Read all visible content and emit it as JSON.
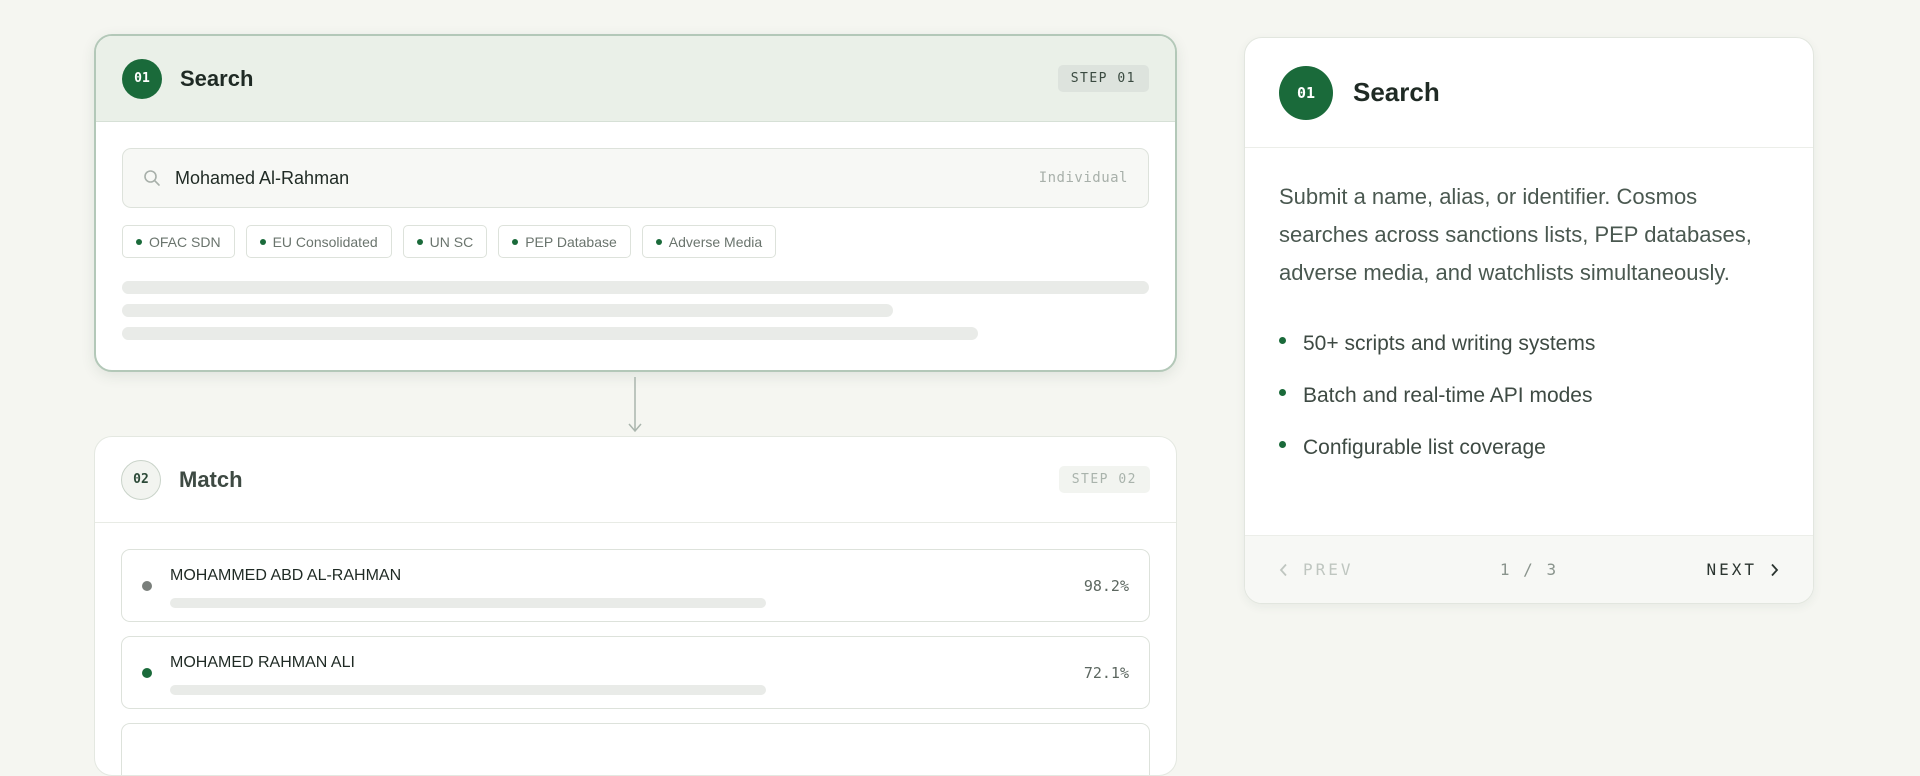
{
  "step1": {
    "number": "01",
    "title": "Search",
    "tag": "STEP 01",
    "search": {
      "value": "Mohamed Al-Rahman",
      "type": "Individual"
    },
    "chips": [
      "OFAC SDN",
      "EU Consolidated",
      "UN SC",
      "PEP Database",
      "Adverse Media"
    ]
  },
  "step2": {
    "number": "02",
    "title": "Match",
    "tag": "STEP 02",
    "matches": [
      {
        "name": "MOHAMMED ABD AL-RAHMAN",
        "score": "98.2%",
        "dot_color": "#7a7f7b"
      },
      {
        "name": "MOHAMED RAHMAN ALI",
        "score": "72.1%",
        "dot_color": "#1a6a3a"
      }
    ]
  },
  "panel": {
    "number": "01",
    "title": "Search",
    "description": "Submit a name, alias, or identifier. Cosmos searches across sanctions lists, PEP databases, adverse media, and watchlists simultaneously.",
    "bullets": [
      "50+ scripts and writing systems",
      "Batch and real-time API modes",
      "Configurable list coverage"
    ],
    "prev_label": "PREV",
    "next_label": "NEXT",
    "pager": "1 / 3"
  },
  "colors": {
    "accent": "#1a6a3a",
    "active_border": "#b3c8b8",
    "background": "#f5f6f1"
  }
}
